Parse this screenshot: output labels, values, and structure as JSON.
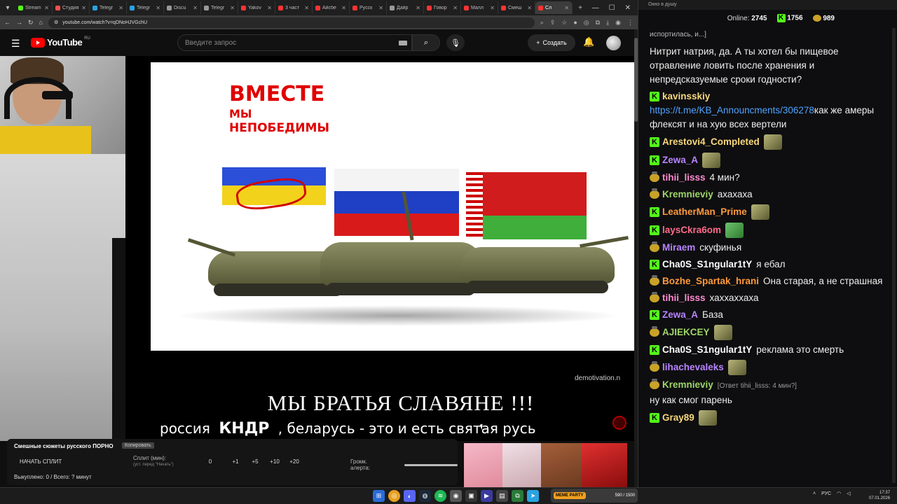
{
  "browser": {
    "tabs": [
      {
        "label": "Stream",
        "color": "#53fc18"
      },
      {
        "label": "Студия",
        "color": "#ff4d4d"
      },
      {
        "label": "Telegr",
        "color": "#2aa3e0"
      },
      {
        "label": "Telegr",
        "color": "#2aa3e0"
      },
      {
        "label": "Discu",
        "color": "#999999"
      },
      {
        "label": "Telegr",
        "color": "#999999"
      },
      {
        "label": "Yakov",
        "color": "#ff3333"
      },
      {
        "label": "3 част",
        "color": "#ff3333"
      },
      {
        "label": "Айсбе",
        "color": "#ff3333"
      },
      {
        "label": "Русск",
        "color": "#ff3333"
      },
      {
        "label": "Дайр",
        "color": "#999999"
      },
      {
        "label": "Говор",
        "color": "#ff3333"
      },
      {
        "label": "Малл",
        "color": "#ff3333"
      },
      {
        "label": "Смеш",
        "color": "#ff3333"
      },
      {
        "label": "Сл",
        "color": "#ff3333"
      }
    ],
    "url": "youtube.com/watch?v=qDNoHJVGchU"
  },
  "youtube": {
    "logo_text": "YouTube",
    "logo_region": "RU",
    "search_placeholder": "Введите запрос",
    "create_label": "Создать"
  },
  "video": {
    "poster_line1": "ВМЕСТЕ",
    "poster_line2": "МЫ",
    "poster_line3": "НЕПОБЕДИМЫ",
    "watermark": "demotivation.n",
    "caption_title": "МЫ БРАТЬЯ СЛАВЯНЕ !!!",
    "caption_a": "россия",
    "caption_b": "КНДР",
    "caption_c": ", беларусь - это и есть святая русь"
  },
  "panel": {
    "title": "Смешные сюжеты русского ПОРНО",
    "copy_label": "Копировать",
    "start_label": "НАЧАТЬ СПЛИТ",
    "split_label": "Сплит (мин):",
    "split_hint": "(уст. перед \"Начать\")",
    "split_value": "0",
    "increments": [
      "+1",
      "+5",
      "+10",
      "+20"
    ],
    "volume_label": "Громк. алерта:",
    "footer": "Выкуплено: 0 / Всего: ? минут"
  },
  "chat": {
    "window_title": "Окно в душу",
    "online_label": "Online:",
    "online_value": "2745",
    "kick_count": "1756",
    "coin_count": "989",
    "messages": [
      {
        "type": "cont",
        "text": "испортилась, и...]"
      },
      {
        "type": "text",
        "text": "Нитрит натрия, да. А ты хотел бы пищевое отравление ловить после хранения и непредсказуемые сроки годности?"
      },
      {
        "type": "msg",
        "badge": "kick",
        "user": "kavinsskiy",
        "color": "#f7d87c",
        "link": "https://t.me/KB_Announcments/306278",
        "text": "как же амеры флексят и на хую всех вертели"
      },
      {
        "type": "msg",
        "badge": "kick",
        "user": "Arestovi4_Completed",
        "color": "#f7d87c",
        "emote": "d",
        "text": ""
      },
      {
        "type": "msg",
        "badge": "kick",
        "user": "Zewa_A",
        "color": "#b884ff",
        "emote": "d",
        "text": ""
      },
      {
        "type": "msg",
        "badge": "coin",
        "user": "tihii_lisss",
        "color": "#ff8ad1",
        "text": "4 мин?"
      },
      {
        "type": "msg",
        "badge": "coin",
        "user": "Kremnieviy",
        "color": "#9fd56a",
        "text": "ахахаха"
      },
      {
        "type": "msg",
        "badge": "kick",
        "user": "LeatherMan_Prime",
        "color": "#ff9a3c",
        "emote": "d",
        "text": ""
      },
      {
        "type": "msg",
        "badge": "kick",
        "user": "laysCkra6om",
        "color": "#ff6a8a",
        "emote": "g",
        "text": ""
      },
      {
        "type": "msg",
        "badge": "coin",
        "user": "Miraem",
        "color": "#b884ff",
        "text": "скуфинья"
      },
      {
        "type": "msg",
        "badge": "kick",
        "user": "Cha0S_S1ngular1tY",
        "color": "#ffffff",
        "text": "я ебал"
      },
      {
        "type": "msg",
        "badge": "coin",
        "user": "Bozhe_Spartak_hrani",
        "color": "#ff9a3c",
        "text": "Она старая, а не страшная"
      },
      {
        "type": "msg",
        "badge": "coin",
        "user": "tihii_lisss",
        "color": "#ff8ad1",
        "text": "хаххаххаха"
      },
      {
        "type": "msg",
        "badge": "kick",
        "user": "Zewa_A",
        "color": "#b884ff",
        "text": "База"
      },
      {
        "type": "msg",
        "badge": "coin",
        "user": "AJIEKCEY",
        "color": "#9fd56a",
        "emote": "d",
        "text": ""
      },
      {
        "type": "msg",
        "badge": "kick",
        "user": "Cha0S_S1ngular1tY",
        "color": "#ffffff",
        "text": "реклама это смерть"
      },
      {
        "type": "msg",
        "badge": "coin",
        "user": "lihachevaleks",
        "color": "#b884ff",
        "emote": "d",
        "text": ""
      },
      {
        "type": "msg",
        "badge": "coin",
        "user": "Kremnieviy",
        "color": "#9fd56a",
        "reply": "[Ответ tihii_lisss: 4 мин?]",
        "text": "ну как смог парень"
      },
      {
        "type": "msg",
        "badge": "kick",
        "user": "Gray89",
        "color": "#f7d87c",
        "emote": "d",
        "text": ""
      }
    ]
  },
  "taskbar": {
    "game_label": "MEME PARTY",
    "game_progress": "590 / 1500",
    "lang": "РУС",
    "time": "17:37",
    "date": "07.01.2026"
  }
}
